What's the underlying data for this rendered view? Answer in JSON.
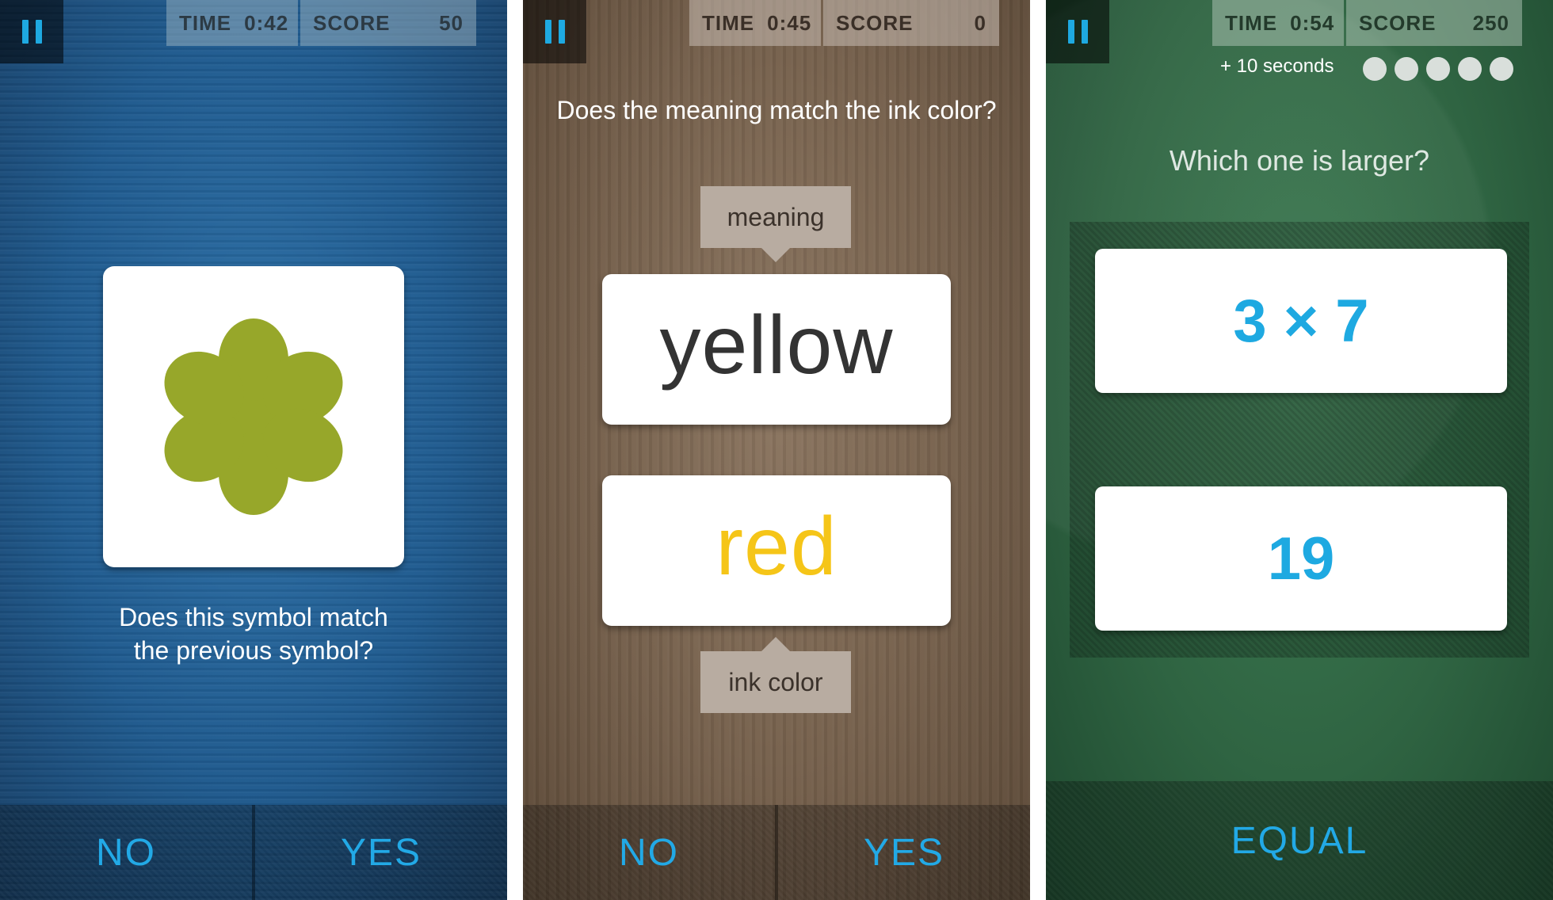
{
  "panels": {
    "symbol": {
      "hud": {
        "time_label": "TIME",
        "time_value": "0:42",
        "score_label": "SCORE",
        "score_value": "50"
      },
      "prompt_line1": "Does this symbol match",
      "prompt_line2": "the previous symbol?",
      "symbol_icon": "six-petal-flower-icon",
      "symbol_color": "#97a72a",
      "no_label": "NO",
      "yes_label": "YES"
    },
    "stroop": {
      "hud": {
        "time_label": "TIME",
        "time_value": "0:45",
        "score_label": "SCORE",
        "score_value": "0"
      },
      "prompt": "Does the meaning match the ink color?",
      "meaning_tag": "meaning",
      "meaning_word": "yellow",
      "meaning_word_color": "#333333",
      "ink_word": "red",
      "ink_word_color": "#f5c518",
      "ink_tag": "ink color",
      "no_label": "NO",
      "yes_label": "YES"
    },
    "math": {
      "hud": {
        "time_label": "TIME",
        "time_value": "0:54",
        "score_label": "SCORE",
        "score_value": "250"
      },
      "bonus_text": "+ 10 seconds",
      "progress_dots": 5,
      "prompt": "Which one is larger?",
      "option_a": "3 × 7",
      "option_b": "19",
      "equal_label": "EQUAL",
      "accent_color": "#1ea9e1"
    }
  }
}
